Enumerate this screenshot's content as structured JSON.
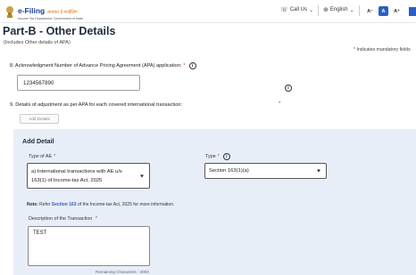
{
  "header": {
    "logo_main": "e-Filing",
    "logo_hindi": "आयकर ई-फाईलिंग",
    "logo_sub": "Income Tax Department, Government of India",
    "call_us": "Call Us",
    "language": "English",
    "font_decrease": "A⁻",
    "font_normal": "A",
    "font_increase": "A⁺"
  },
  "page": {
    "title": "Part-B - Other Details",
    "subtitle": "(Includes Other details of APA)",
    "mandatory_note": "* Indicates mandatory fields"
  },
  "q8": {
    "label": "8. Acknowledgment Number of Advance Pricing Agreement (APA) application:",
    "required": "*",
    "value": "1234567890"
  },
  "q9": {
    "label": "9. Details of adjustment as per APA for each covered international transaction:",
    "star": "*",
    "add_button": "Add Details"
  },
  "add_detail": {
    "title": "Add Detail",
    "type_of_ae_label": "Type of AE",
    "type_of_ae_required": "*",
    "type_of_ae_value": "a) International transactions with AE u/s 163(1) of Income-tax Act, 2025",
    "type_label": "Type",
    "type_required": "*",
    "type_value": "Section 163(1)(a)",
    "note_prefix": "Note:",
    "note_refer": " Refer ",
    "note_link": "Section 163",
    "note_suffix": " of the Income-tax Act, 2025 for more information.",
    "description_label": "Description of the Transaction",
    "description_required": "*",
    "description_value": "TEST",
    "remaining": "Remaining Characters : 4000"
  },
  "colors": {
    "brand_blue": "#1d3f8f",
    "accent_blue": "#2a5fc4",
    "panel_bg": "#e8eef8",
    "required_red": "#c0392b"
  }
}
